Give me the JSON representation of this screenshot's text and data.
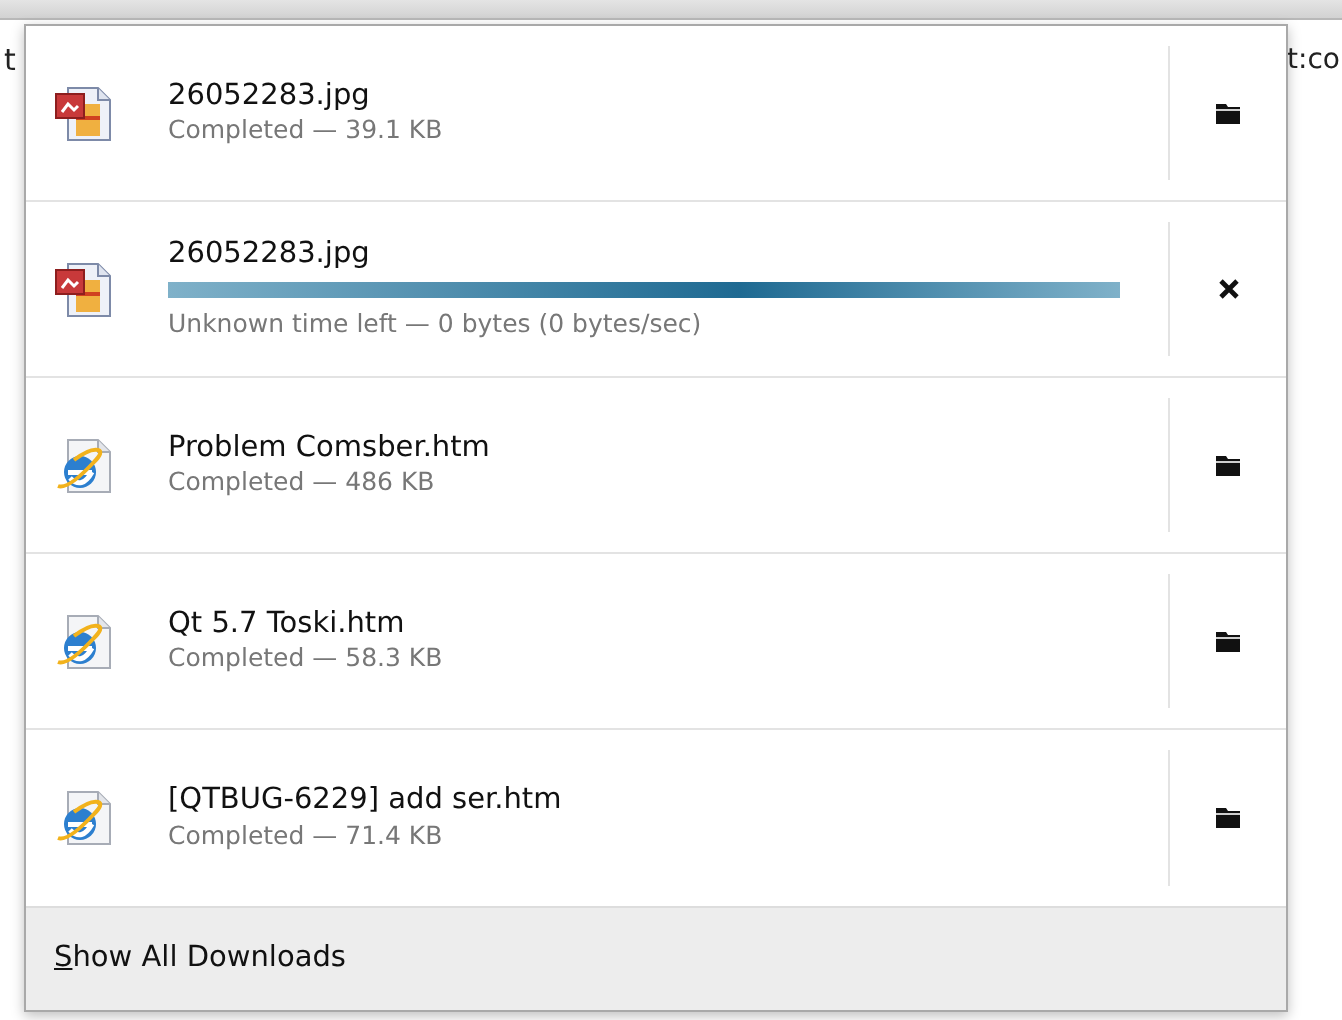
{
  "background": {
    "left_text": "t",
    "right_text": "t:co"
  },
  "downloads": [
    {
      "kind": "image",
      "name": "26052283.jpg",
      "status": "Completed — 39.1 KB",
      "in_progress": false
    },
    {
      "kind": "image",
      "name": "26052283.jpg",
      "status": "Unknown time left — 0 bytes (0 bytes/sec)",
      "in_progress": true,
      "level": 1
    },
    {
      "kind": "webpage",
      "name": "Problem Comsber.htm",
      "status": "Completed — 486 KB",
      "in_progress": false
    },
    {
      "kind": "webpage",
      "name": "Qt 5.7 Toski.htm",
      "status": "Completed — 58.3 KB",
      "in_progress": false
    },
    {
      "kind": "webpage",
      "name": "[QTBUG-6229] add ser.htm",
      "status": "Completed — 71.4 KB",
      "in_progress": false
    }
  ],
  "footer": {
    "label": "Show All Downloads"
  }
}
